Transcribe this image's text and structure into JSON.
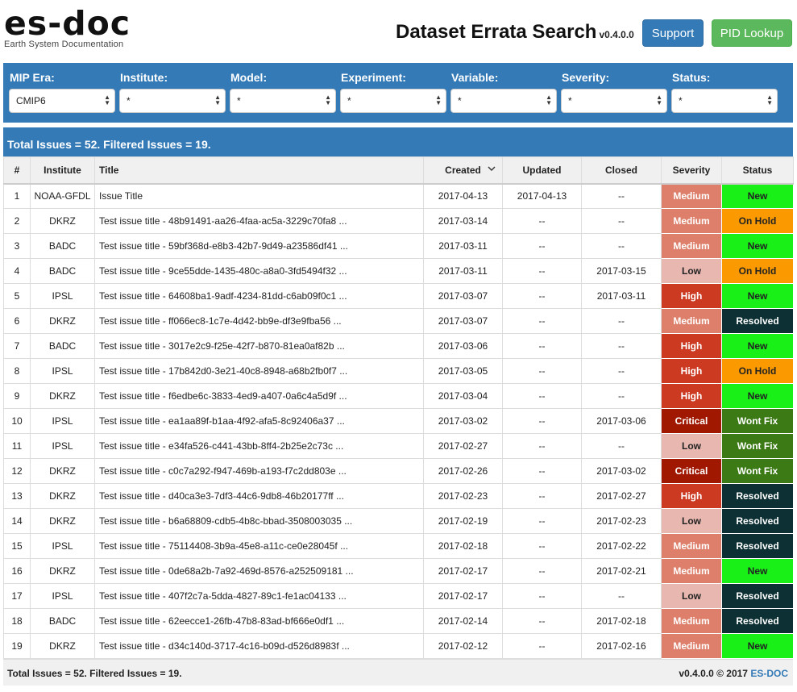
{
  "header": {
    "logo": "es-doc",
    "logo_subtitle": "Earth System Documentation",
    "title": "Dataset Errata Search",
    "version": "v0.4.0.0",
    "support_label": "Support",
    "pid_label": "PID Lookup"
  },
  "colors": {
    "primary": "#337ab7",
    "success": "#5cb85c",
    "sev_low": "#e8b8b0",
    "sev_medium": "#dd7f6a",
    "sev_high": "#cd3a22",
    "sev_critical": "#a01800",
    "stat_new": "#18f018",
    "stat_onhold": "#fa9a00",
    "stat_resolved": "#0d3034",
    "stat_wontfix": "#3c7a16"
  },
  "filters": [
    {
      "label": "MIP Era:",
      "value": "CMIP6"
    },
    {
      "label": "Institute:",
      "value": "*"
    },
    {
      "label": "Model:",
      "value": "*"
    },
    {
      "label": "Experiment:",
      "value": "*"
    },
    {
      "label": "Variable:",
      "value": "*"
    },
    {
      "label": "Severity:",
      "value": "*"
    },
    {
      "label": "Status:",
      "value": "*"
    }
  ],
  "summary": "Total Issues = 52. Filtered Issues = 19.",
  "table": {
    "headers": [
      "#",
      "Institute",
      "Title",
      "Created",
      "Updated",
      "Closed",
      "Severity",
      "Status"
    ],
    "rows": [
      {
        "n": "1",
        "institute": "NOAA-GFDL",
        "title": "Issue Title",
        "created": "2017-04-13",
        "updated": "2017-04-13",
        "closed": "--",
        "severity": "Medium",
        "status": "New"
      },
      {
        "n": "2",
        "institute": "DKRZ",
        "title": "Test issue title - 48b91491-aa26-4faa-ac5a-3229c70fa8 ...",
        "created": "2017-03-14",
        "updated": "--",
        "closed": "--",
        "severity": "Medium",
        "status": "On Hold"
      },
      {
        "n": "3",
        "institute": "BADC",
        "title": "Test issue title - 59bf368d-e8b3-42b7-9d49-a23586df41 ...",
        "created": "2017-03-11",
        "updated": "--",
        "closed": "--",
        "severity": "Medium",
        "status": "New"
      },
      {
        "n": "4",
        "institute": "BADC",
        "title": "Test issue title - 9ce55dde-1435-480c-a8a0-3fd5494f32 ...",
        "created": "2017-03-11",
        "updated": "--",
        "closed": "2017-03-15",
        "severity": "Low",
        "status": "On Hold"
      },
      {
        "n": "5",
        "institute": "IPSL",
        "title": "Test issue title - 64608ba1-9adf-4234-81dd-c6ab09f0c1 ...",
        "created": "2017-03-07",
        "updated": "--",
        "closed": "2017-03-11",
        "severity": "High",
        "status": "New"
      },
      {
        "n": "6",
        "institute": "DKRZ",
        "title": "Test issue title - ff066ec8-1c7e-4d42-bb9e-df3e9fba56 ...",
        "created": "2017-03-07",
        "updated": "--",
        "closed": "--",
        "severity": "Medium",
        "status": "Resolved"
      },
      {
        "n": "7",
        "institute": "BADC",
        "title": "Test issue title - 3017e2c9-f25e-42f7-b870-81ea0af82b ...",
        "created": "2017-03-06",
        "updated": "--",
        "closed": "--",
        "severity": "High",
        "status": "New"
      },
      {
        "n": "8",
        "institute": "IPSL",
        "title": "Test issue title - 17b842d0-3e21-40c8-8948-a68b2fb0f7 ...",
        "created": "2017-03-05",
        "updated": "--",
        "closed": "--",
        "severity": "High",
        "status": "On Hold"
      },
      {
        "n": "9",
        "institute": "DKRZ",
        "title": "Test issue title - f6edbe6c-3833-4ed9-a407-0a6c4a5d9f ...",
        "created": "2017-03-04",
        "updated": "--",
        "closed": "--",
        "severity": "High",
        "status": "New"
      },
      {
        "n": "10",
        "institute": "IPSL",
        "title": "Test issue title - ea1aa89f-b1aa-4f92-afa5-8c92406a37 ...",
        "created": "2017-03-02",
        "updated": "--",
        "closed": "2017-03-06",
        "severity": "Critical",
        "status": "Wont Fix"
      },
      {
        "n": "11",
        "institute": "IPSL",
        "title": "Test issue title - e34fa526-c441-43bb-8ff4-2b25e2c73c ...",
        "created": "2017-02-27",
        "updated": "--",
        "closed": "--",
        "severity": "Low",
        "status": "Wont Fix"
      },
      {
        "n": "12",
        "institute": "DKRZ",
        "title": "Test issue title - c0c7a292-f947-469b-a193-f7c2dd803e ...",
        "created": "2017-02-26",
        "updated": "--",
        "closed": "2017-03-02",
        "severity": "Critical",
        "status": "Wont Fix"
      },
      {
        "n": "13",
        "institute": "DKRZ",
        "title": "Test issue title - d40ca3e3-7df3-44c6-9db8-46b20177ff ...",
        "created": "2017-02-23",
        "updated": "--",
        "closed": "2017-02-27",
        "severity": "High",
        "status": "Resolved"
      },
      {
        "n": "14",
        "institute": "DKRZ",
        "title": "Test issue title - b6a68809-cdb5-4b8c-bbad-3508003035 ...",
        "created": "2017-02-19",
        "updated": "--",
        "closed": "2017-02-23",
        "severity": "Low",
        "status": "Resolved"
      },
      {
        "n": "15",
        "institute": "IPSL",
        "title": "Test issue title - 75114408-3b9a-45e8-a11c-ce0e28045f ...",
        "created": "2017-02-18",
        "updated": "--",
        "closed": "2017-02-22",
        "severity": "Medium",
        "status": "Resolved"
      },
      {
        "n": "16",
        "institute": "DKRZ",
        "title": "Test issue title - 0de68a2b-7a92-469d-8576-a252509181 ...",
        "created": "2017-02-17",
        "updated": "--",
        "closed": "2017-02-21",
        "severity": "Medium",
        "status": "New"
      },
      {
        "n": "17",
        "institute": "IPSL",
        "title": "Test issue title - 407f2c7a-5dda-4827-89c1-fe1ac04133 ...",
        "created": "2017-02-17",
        "updated": "--",
        "closed": "--",
        "severity": "Low",
        "status": "Resolved"
      },
      {
        "n": "18",
        "institute": "BADC",
        "title": "Test issue title - 62eecce1-26fb-47b8-83ad-bf666e0df1 ...",
        "created": "2017-02-14",
        "updated": "--",
        "closed": "2017-02-18",
        "severity": "Medium",
        "status": "Resolved"
      },
      {
        "n": "19",
        "institute": "DKRZ",
        "title": "Test issue title - d34c140d-3717-4c16-b09d-d526d8983f ...",
        "created": "2017-02-12",
        "updated": "--",
        "closed": "2017-02-16",
        "severity": "Medium",
        "status": "New"
      }
    ]
  },
  "footer": {
    "summary": "Total Issues = 52. Filtered Issues = 19.",
    "copyright": "v0.4.0.0 © 2017",
    "link": "ES-DOC"
  }
}
